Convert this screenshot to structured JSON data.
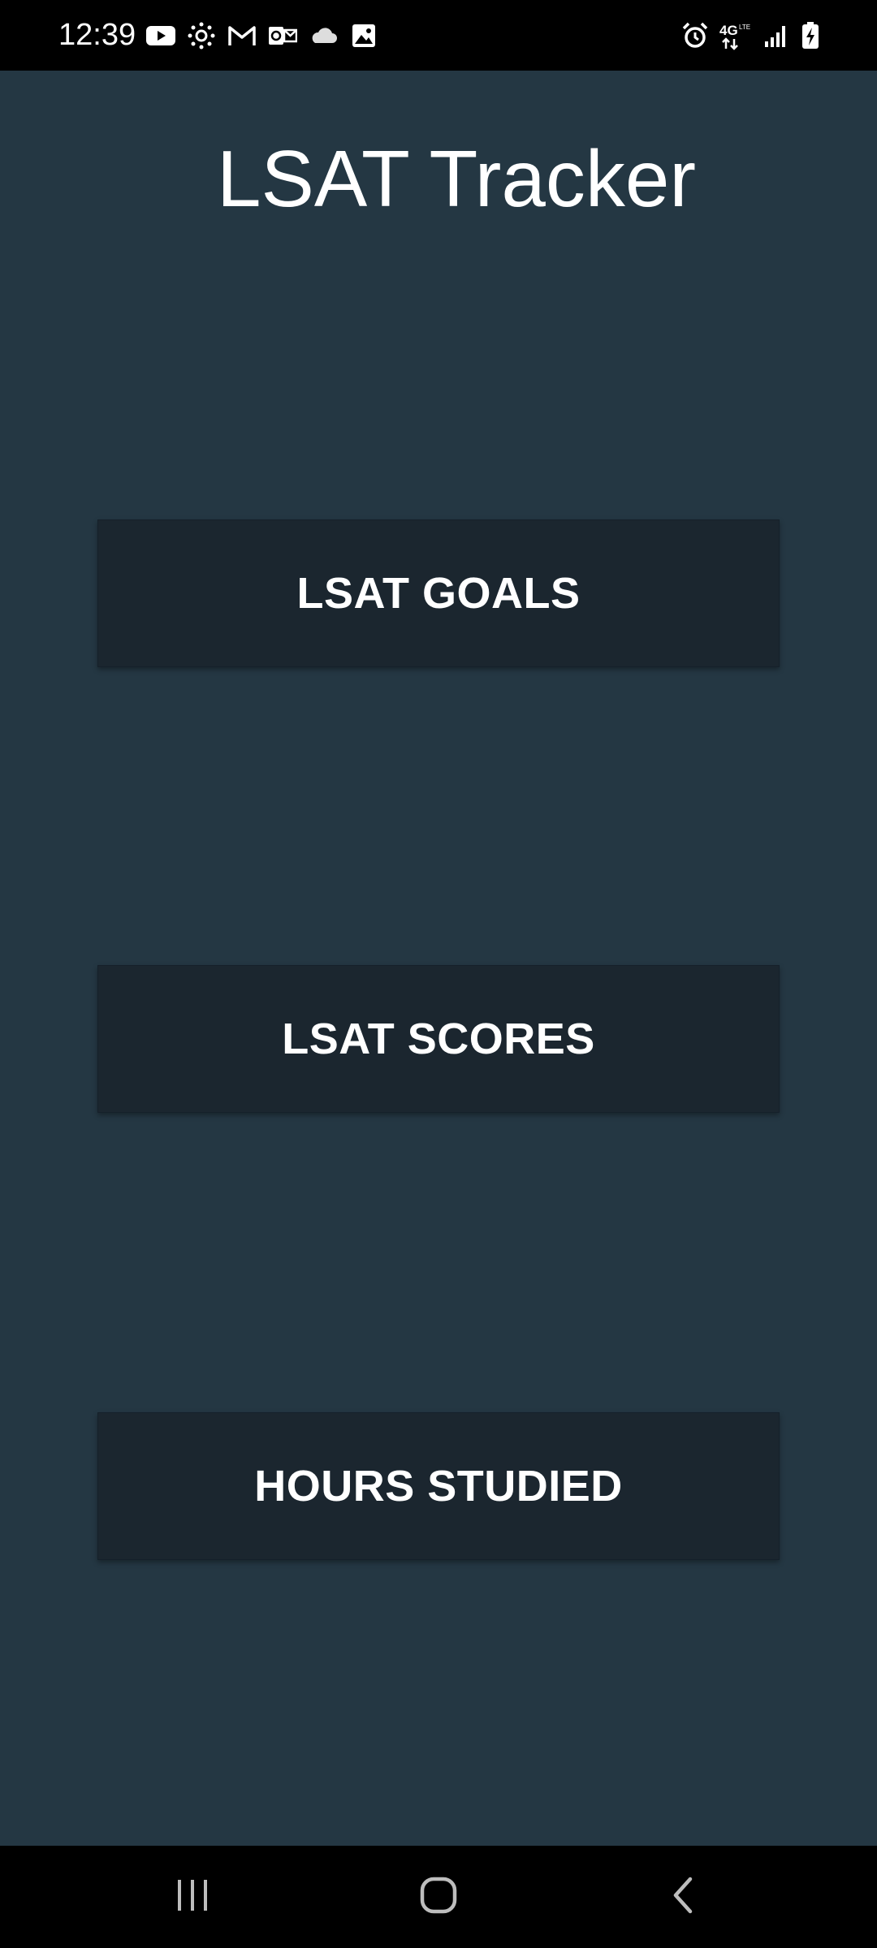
{
  "status_bar": {
    "time": "12:39",
    "left_icons": [
      "youtube-icon",
      "canvas-icon",
      "gmail-icon",
      "outlook-icon",
      "onedrive-icon",
      "gallery-icon"
    ],
    "right_icons": [
      "alarm-icon",
      "4g-lte-icon",
      "signal-icon",
      "battery-charging-icon"
    ]
  },
  "app": {
    "title": "LSAT Tracker"
  },
  "menu": {
    "goals_label": "LSAT GOALS",
    "scores_label": "LSAT SCORES",
    "hours_label": "HOURS STUDIED"
  },
  "nav_bar": {
    "icons": [
      "recents-icon",
      "home-icon",
      "back-icon"
    ]
  },
  "colors": {
    "background": "#243743",
    "button": "#1b262f",
    "text": "#ffffff"
  }
}
